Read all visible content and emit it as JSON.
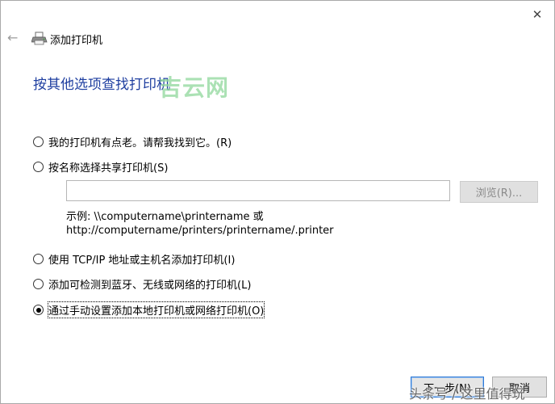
{
  "window": {
    "close_glyph": "✕",
    "back_glyph": "←"
  },
  "wizard": {
    "title": "添加打印机",
    "heading": "按其他选项查找打印机",
    "printer_icon": "printer-icon"
  },
  "options": [
    {
      "label": "我的打印机有点老。请帮我找到它。(R)",
      "checked": false
    },
    {
      "label": "按名称选择共享打印机(S)",
      "checked": false
    },
    {
      "label": "使用 TCP/IP 地址或主机名添加打印机(I)",
      "checked": false
    },
    {
      "label": "添加可检测到蓝牙、无线或网络的打印机(L)",
      "checked": false
    },
    {
      "label": "通过手动设置添加本地打印机或网络打印机(O)",
      "checked": true
    }
  ],
  "share": {
    "input_value": "",
    "browse_label": "浏览(R)...",
    "example_line1": "示例: \\\\computername\\printername 或",
    "example_line2": "http://computername/printers/printername/.printer"
  },
  "footer": {
    "next_label": "下一步(N)",
    "cancel_label": "取消"
  },
  "watermarks": {
    "top": "吉云网",
    "bottom": "头条号 / 这里值得玩"
  },
  "colors": {
    "heading": "#1f3fa0",
    "focus_border": "#2d79d6",
    "disabled_text": "#8a8a8a"
  }
}
